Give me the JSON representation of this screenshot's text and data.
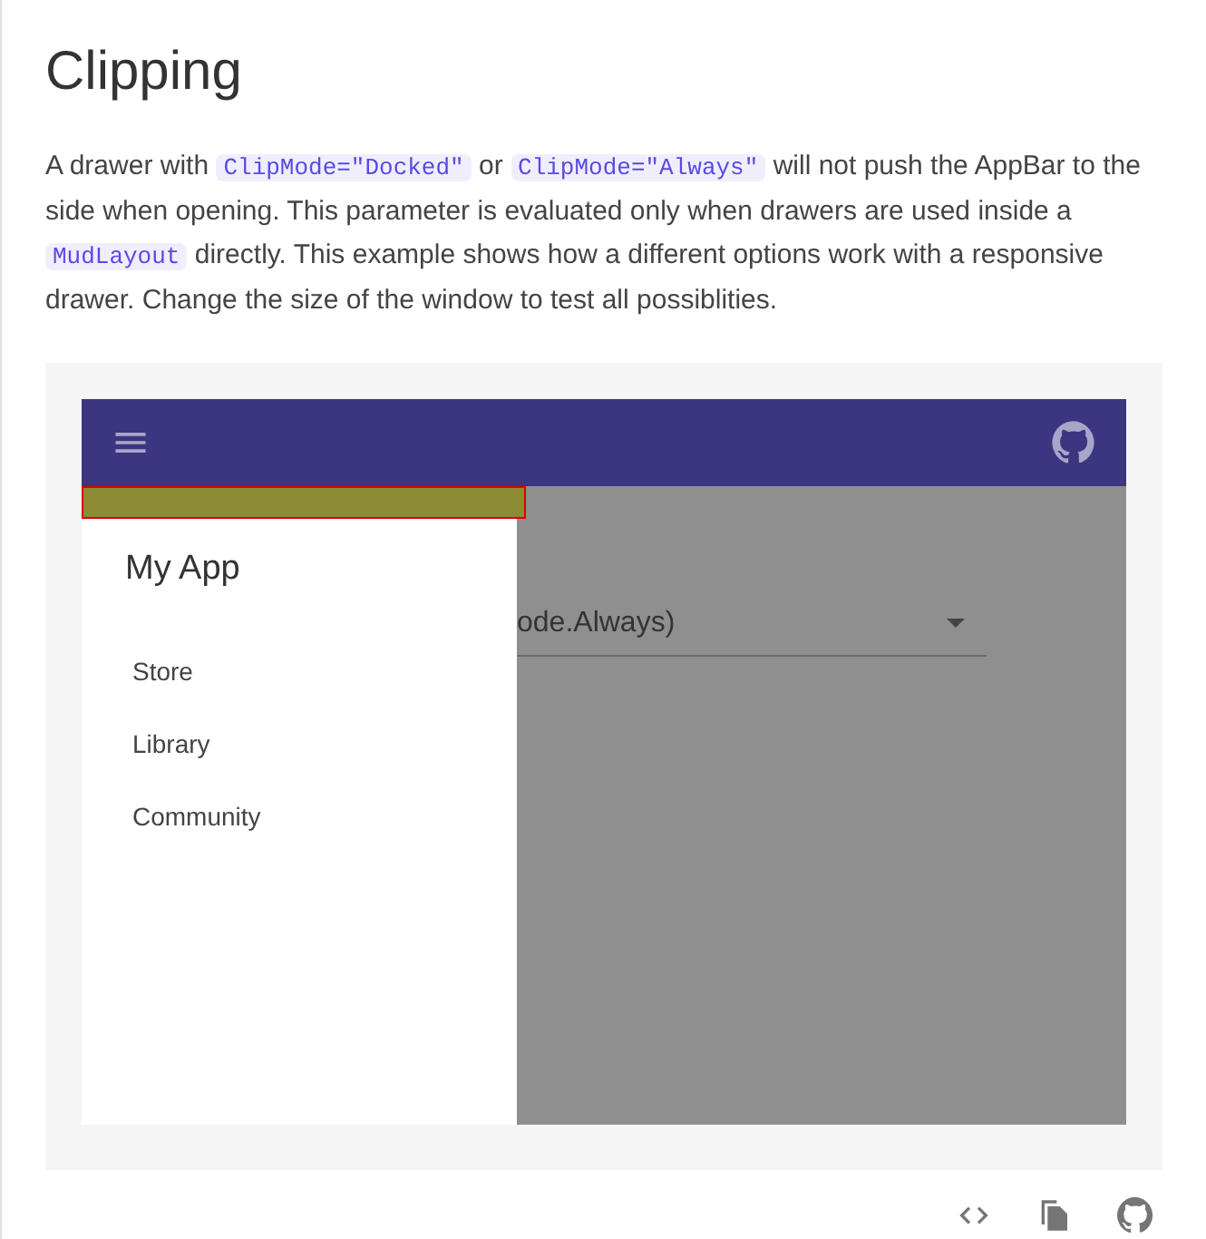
{
  "title": "Clipping",
  "description": [
    {
      "kind": "text",
      "text": "A drawer with "
    },
    {
      "kind": "code",
      "text": "ClipMode=\"Docked\""
    },
    {
      "kind": "text",
      "text": " or "
    },
    {
      "kind": "code",
      "text": "ClipMode=\"Always\""
    },
    {
      "kind": "text",
      "text": " will not push the AppBar to the side when opening. This parameter is evaluated only when drawers are used inside a "
    },
    {
      "kind": "code",
      "text": "MudLayout"
    },
    {
      "kind": "text",
      "text": " directly. This example shows how a different options work with a responsive drawer. Change the size of the window to test all possiblities."
    }
  ],
  "demo": {
    "drawer": {
      "title": "My App",
      "open": true,
      "items": [
        "Store",
        "Library",
        "Community"
      ]
    },
    "select": {
      "value": "ode.Always)"
    }
  }
}
